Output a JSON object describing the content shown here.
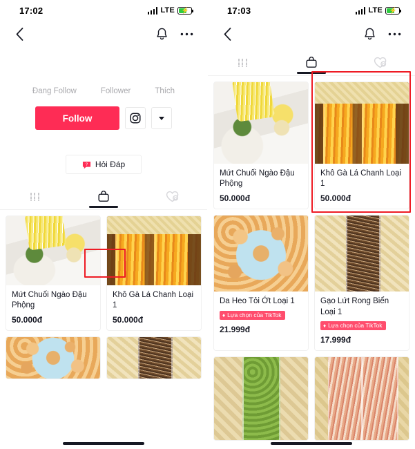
{
  "colors": {
    "brand_red": "#FE2C55",
    "badge_pink": "#FF4D6D",
    "annotation_red": "#EE1B24",
    "text_primary": "#161823",
    "text_muted": "#A9A9AD"
  },
  "left_phone": {
    "status_bar": {
      "time": "17:02",
      "network": "LTE",
      "signal_icon": "signal-bars-icon",
      "battery_icon": "battery-charging-icon"
    },
    "nav": {
      "back_icon": "chevron-left-icon",
      "bell_icon": "bell-icon",
      "more_icon": "more-horizontal-icon"
    },
    "profile": {
      "stats": [
        {
          "label": "Đang Follow"
        },
        {
          "label": "Follower"
        },
        {
          "label": "Thích"
        }
      ],
      "follow_label": "Follow",
      "instagram_icon": "instagram-icon",
      "dropdown_icon": "chevron-down-icon",
      "qa_label": "Hỏi Đáp",
      "qa_icon": "qa-bubble-icon"
    },
    "tabs": [
      {
        "name": "posts",
        "icon": "grid-posts-icon",
        "active": false
      },
      {
        "name": "shop",
        "icon": "shopping-bag-icon",
        "active": true
      },
      {
        "name": "liked",
        "icon": "heart-lock-icon",
        "active": false
      }
    ],
    "products": [
      {
        "name": "Mứt Chuối Ngào Đậu Phộng",
        "price": "50.000đ",
        "badge": null,
        "art": "img-mut"
      },
      {
        "name": "Khô Gà Lá Chanh Loại 1",
        "price": "50.000đ",
        "badge": null,
        "art": "img-kho"
      }
    ],
    "partial_products": [
      {
        "art": "img-da"
      },
      {
        "art": "img-gao"
      }
    ]
  },
  "right_phone": {
    "status_bar": {
      "time": "17:03",
      "network": "LTE",
      "signal_icon": "signal-bars-icon",
      "battery_icon": "battery-charging-icon"
    },
    "nav": {
      "back_icon": "chevron-left-icon",
      "bell_icon": "bell-icon",
      "more_icon": "more-horizontal-icon"
    },
    "tabs": [
      {
        "name": "posts",
        "icon": "grid-posts-icon",
        "active": false
      },
      {
        "name": "shop",
        "icon": "shopping-bag-icon",
        "active": true
      },
      {
        "name": "liked",
        "icon": "heart-lock-icon",
        "active": false
      }
    ],
    "products": [
      {
        "name": "Mứt Chuối Ngào Đậu Phộng",
        "price": "50.000đ",
        "badge": null,
        "art": "img-mut"
      },
      {
        "name": "Khô Gà Lá Chanh Loại 1",
        "price": "50.000đ",
        "badge": null,
        "art": "img-kho"
      },
      {
        "name": "Da Heo Tỏi Ớt Loại 1",
        "price": "21.999đ",
        "badge": "Lựa chọn của TikTok",
        "art": "img-da"
      },
      {
        "name": "Gạo Lứt Rong Biển Loại 1",
        "price": "17.999đ",
        "badge": "Lựa chọn của TikTok",
        "art": "img-gao"
      }
    ],
    "partial_products": [
      {
        "art": "img-dau"
      },
      {
        "art": "img-kho2"
      }
    ]
  },
  "annotations": [
    {
      "target": "left-shop-tab",
      "color": "#EE1B24"
    },
    {
      "target": "right-product-card-kho-ga",
      "color": "#EE1B24"
    }
  ]
}
